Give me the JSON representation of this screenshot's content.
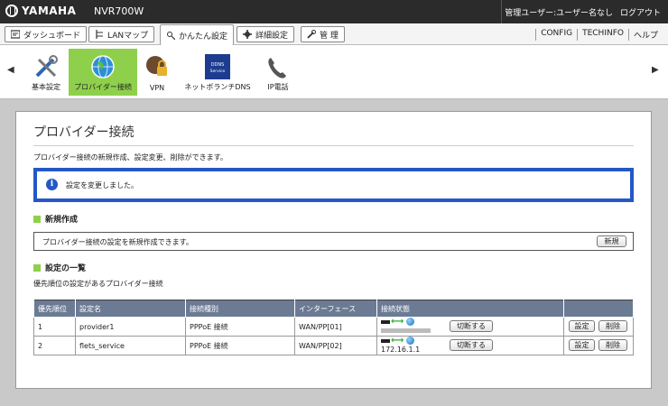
{
  "header": {
    "brand": "YAMAHA",
    "model": "NVR700W",
    "user": "管理ユーザー:ユーザー名なし",
    "logout": "ログアウト"
  },
  "tabs": [
    {
      "label": "ダッシュボード",
      "icon": "dashboard-icon"
    },
    {
      "label": "LANマップ",
      "icon": "lan-map-icon"
    },
    {
      "label": "かんたん設定",
      "icon": "easy-setup-icon"
    },
    {
      "label": "詳細設定",
      "icon": "gear-icon"
    },
    {
      "label": "管 理",
      "icon": "wrench-icon"
    }
  ],
  "utility": [
    "CONFIG",
    "TECHINFO",
    "ヘルプ"
  ],
  "menu": [
    {
      "label": "基本設定",
      "icon": "tools-icon"
    },
    {
      "label": "プロバイダー接続",
      "icon": "globe-icon"
    },
    {
      "label": "VPN",
      "icon": "vpn-lock-icon"
    },
    {
      "label": "ネットボランチDNS",
      "icon": "ddns-service-icon",
      "icon_text": "DDNS Service"
    },
    {
      "label": "IP電話",
      "icon": "phone-icon"
    }
  ],
  "page": {
    "title": "プロバイダー接続",
    "description": "プロバイダー接続の新規作成、設定変更、削除ができます。",
    "notice": "設定を変更しました。",
    "new_section": {
      "heading": "新規作成",
      "text": "プロバイダー接続の設定を新規作成できます。",
      "button": "新規"
    },
    "list_section": {
      "heading": "設定の一覧",
      "description": "優先順位の設定があるプロバイダー接続",
      "columns": [
        "優先順位",
        "設定名",
        "接続種別",
        "インターフェース",
        "接続状態",
        ""
      ],
      "rows": [
        {
          "priority": "1",
          "name": "provider1",
          "type": "PPPoE 接続",
          "interface": "WAN/PP[01]",
          "ip": "",
          "disconnect": "切断する",
          "edit": "設定",
          "delete": "削除"
        },
        {
          "priority": "2",
          "name": "flets_service",
          "type": "PPPoE 接続",
          "interface": "WAN/PP[02]",
          "ip": "172.16.1.1",
          "disconnect": "切断する",
          "edit": "設定",
          "delete": "削除"
        }
      ]
    }
  },
  "colors": {
    "accent_green": "#8ed04b",
    "notice_blue": "#2458c4",
    "table_header": "#6c7b94"
  }
}
